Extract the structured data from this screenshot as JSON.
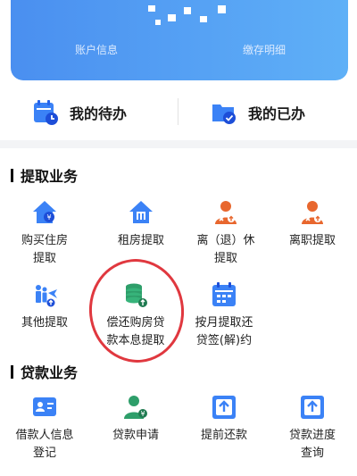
{
  "banner": {
    "account_info": "账户信息",
    "deposit_detail": "缴存明细"
  },
  "quick": {
    "todo": "我的待办",
    "done": "我的已办"
  },
  "withdraw": {
    "title": "提取业务",
    "items": [
      {
        "label": "购买住房\n提取",
        "icon": "house-purchase-icon"
      },
      {
        "label": "租房提取",
        "icon": "house-rent-icon"
      },
      {
        "label": "离（退）休\n提取",
        "icon": "retire-person-icon"
      },
      {
        "label": "离职提取",
        "icon": "resign-person-icon"
      },
      {
        "label": "其他提取",
        "icon": "family-other-icon"
      },
      {
        "label": "偿还购房贷\n款本息提取",
        "icon": "coin-stack-icon"
      },
      {
        "label": "按月提取还\n贷签(解)约",
        "icon": "calendar-building-icon"
      }
    ]
  },
  "loan": {
    "title": "贷款业务",
    "items": [
      {
        "label": "借款人信息\n登记",
        "icon": "borrower-card-icon"
      },
      {
        "label": "贷款申请",
        "icon": "loan-person-icon"
      },
      {
        "label": "提前还款",
        "icon": "prepay-upload-icon"
      },
      {
        "label": "贷款进度\n查询",
        "icon": "progress-upload-icon"
      }
    ]
  },
  "colors": {
    "accent_blue": "#3b82f6",
    "accent_orange": "#e8672e",
    "accent_green": "#2e9e6a",
    "annotation_red": "#e0383f"
  }
}
